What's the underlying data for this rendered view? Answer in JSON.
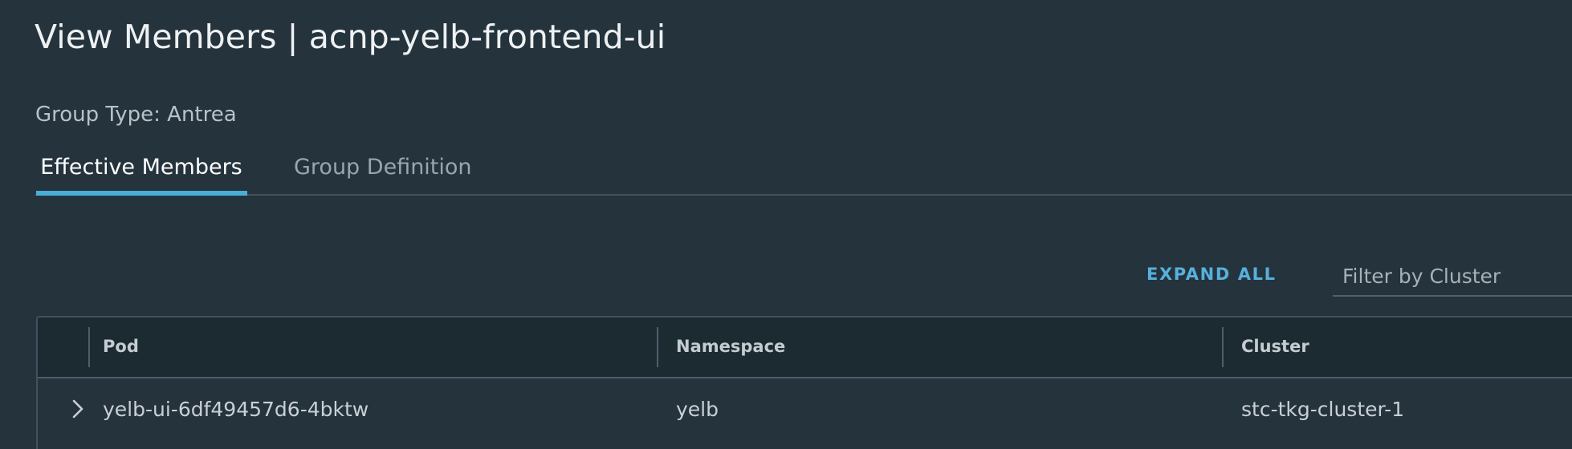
{
  "page": {
    "title": "View Members | acnp-yelb-frontend-ui",
    "group_type": "Group Type: Antrea"
  },
  "tabs": [
    {
      "label": "Effective Members",
      "active": true
    },
    {
      "label": "Group Definition",
      "active": false
    }
  ],
  "toolbar": {
    "expand_all_label": "EXPAND ALL",
    "filter_placeholder": "Filter by Cluster",
    "filter_value": ""
  },
  "table": {
    "columns": [
      "Pod",
      "Namespace",
      "Cluster"
    ],
    "rows": [
      {
        "pod": "yelb-ui-6df49457d6-4bktw",
        "namespace": "yelb",
        "cluster": "stc-tkg-cluster-1",
        "expanded": false
      }
    ]
  },
  "colors": {
    "background": "#25333d",
    "accent": "#49afd9",
    "header_background": "#1c2a32"
  },
  "icons": {
    "row_expander": "chevron-right-icon"
  }
}
